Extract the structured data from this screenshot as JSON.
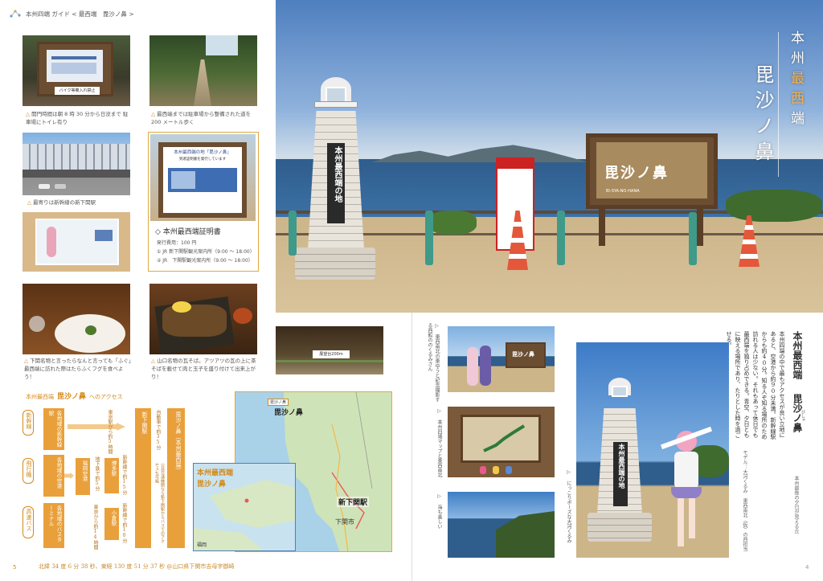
{
  "header": {
    "logo_icon": "constellation-icon",
    "breadcrumb": "本州四端 ガイド < 最西端　毘沙ノ鼻 >"
  },
  "left_photos": {
    "photo1_caption": "開門時間は朝 8 時 30 分から日没まで 駐車場にトイレ有り",
    "photo1_sign": "バイク等乗入れ禁止",
    "photo2_caption": "最西端までは駐車場から整備された道を 200 メートル歩く",
    "photo3_caption": "最寄りは新幹線の新下関駅",
    "photo5_caption": "下関名物と言ったらなんと言っても「ふぐ」最西端に訪れた際はたらふくフグを食べよう！",
    "photo6_caption": "山口名物の瓦そば。アツアツの瓦の上に茶そばを載せて肉と玉子を盛り付けて出来上がり！",
    "sign_board": "展望台200m"
  },
  "certificate": {
    "sign_title": "本州最西端の地「毘沙ノ鼻」",
    "sign_sub": "到達証明書を発行しています",
    "title": "◇ 本州最西端証明書",
    "fee_label": "発行費用：100 円",
    "loc1": "① JR 新下関駅観光案内所（9:00 ～ 18:00）",
    "loc2": "② JR　下関駅観光案内所（9:00 ～ 18:00）"
  },
  "access": {
    "title_prefix": "本州最西端",
    "title_main": "毘沙ノ鼻",
    "title_suffix": "へのアクセス",
    "modes": [
      "新幹線",
      "飛行機",
      "高速バス"
    ],
    "col1": [
      "各地域の新幹線駅",
      "各地域の空港",
      "各地域のバスターミナル"
    ],
    "arrow1": "東京駅から約5時間",
    "mid_airport": "福岡空港",
    "arrow_air": "地下鉄で約5分",
    "hakata": "博多駅",
    "kokura": "小倉駅",
    "arrow_bus": "東京から約14時間",
    "shinkansen_short": "新幹線で約15分",
    "shinkansen_short2": "新幹線で約10分",
    "shin_shimo": "新下関駅",
    "car": "自動車で約35分",
    "dest": "毘沙ノ鼻（本州最西端）",
    "note": "公共交通機関なら新下関駅からバスでのアクセスも可能"
  },
  "map": {
    "label1": "本州最西端",
    "label2": "毘沙ノ鼻",
    "station": "新下関駅",
    "city": "下関市",
    "small1": "毘沙ノ鼻",
    "small2": "福岡"
  },
  "footer": {
    "page_left": "5",
    "coords": "北緯 34 度 6 分 38 秒、東経 130 度 51 分 37 秒 @山口県下関市吉母字御崎",
    "page_right": "4"
  },
  "hero": {
    "tower_text": "本州最西端の地",
    "sign_text": "毘沙ノ鼻",
    "sign_sub": "BI-SYA-NO-HANA",
    "title_part1": "本州",
    "title_accent": "最西",
    "title_part2": "端",
    "title_main": "毘沙ノ鼻"
  },
  "right_page": {
    "photo_a_caption": "▷ 東西南北の東ゆうと記念撮影する西館ののくるみさん",
    "photo_b_caption": "▷ 本州四端マップと東西南北",
    "photo_c_caption": "▷ 海も美しい",
    "photo_d_caption": "▷ にっこりポーズな大河くるみ",
    "photo_a_sign": "毘沙ノ鼻",
    "main_tower_text": "本州最西端の地",
    "article_title1": "本州最西端",
    "article_title2": "毘沙ノ鼻",
    "furigana": "びしゃ",
    "article_body": "本州四端の中で最もアクセスが良い立地にあると、空港から約90分未満。新幹線駅からも約40分。知る人ぞ知る場所のため訪れる人は少ない。それもあって休日でも最西端を独り占めできる。青空、夕日ともに映える場所であり、たりとした時を過ごせる。",
    "article_side": "本州最後の夕日が見える丘",
    "model_credit": "モデル：大河くるみ　東西南北（仮）の西担当"
  },
  "colors": {
    "accent": "#d48a1a",
    "gold": "#e1a93e",
    "sea": "#2f5d8c"
  }
}
